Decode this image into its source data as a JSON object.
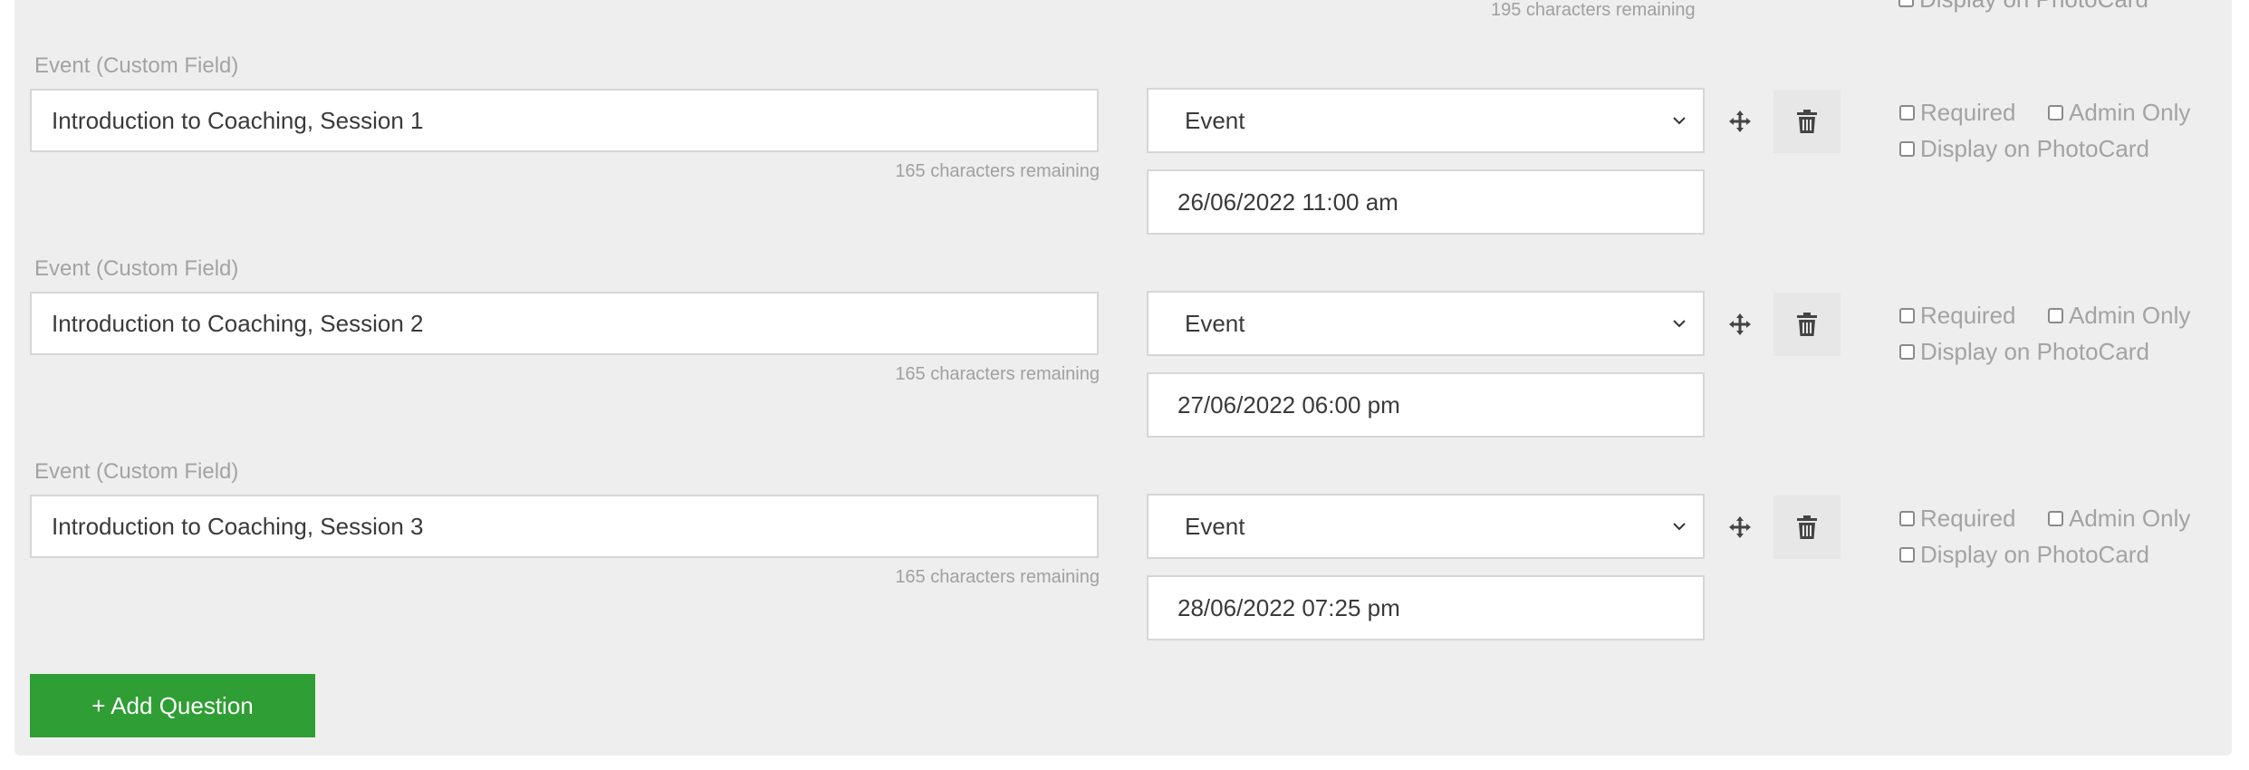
{
  "top_partial": {
    "chars_remaining": "195 characters remaining",
    "display_on_photocard": "Display on PhotoCard"
  },
  "questions": [
    {
      "label": "Event (Custom Field)",
      "value": "Introduction to Coaching, Session 1",
      "chars_remaining": "165 characters remaining",
      "type": "Event",
      "date": "26/06/2022 11:00 am",
      "required_label": "Required",
      "admin_only_label": "Admin Only",
      "photocard_label": "Display on PhotoCard"
    },
    {
      "label": "Event (Custom Field)",
      "value": "Introduction to Coaching, Session 2",
      "chars_remaining": "165 characters remaining",
      "type": "Event",
      "date": "27/06/2022 06:00 pm",
      "required_label": "Required",
      "admin_only_label": "Admin Only",
      "photocard_label": "Display on PhotoCard"
    },
    {
      "label": "Event (Custom Field)",
      "value": "Introduction to Coaching, Session 3",
      "chars_remaining": "165 characters remaining",
      "type": "Event",
      "date": "28/06/2022 07:25 pm",
      "required_label": "Required",
      "admin_only_label": "Admin Only",
      "photocard_label": "Display on PhotoCard"
    }
  ],
  "add_question_label": "+ Add Question",
  "colors": {
    "panel_bg": "#eeeeee",
    "add_button": "#2f9e34",
    "muted_text": "#a3a3a3"
  },
  "icons": {
    "move": "move-arrows-icon",
    "delete": "trash-icon",
    "dropdown": "chevron-down-icon"
  }
}
